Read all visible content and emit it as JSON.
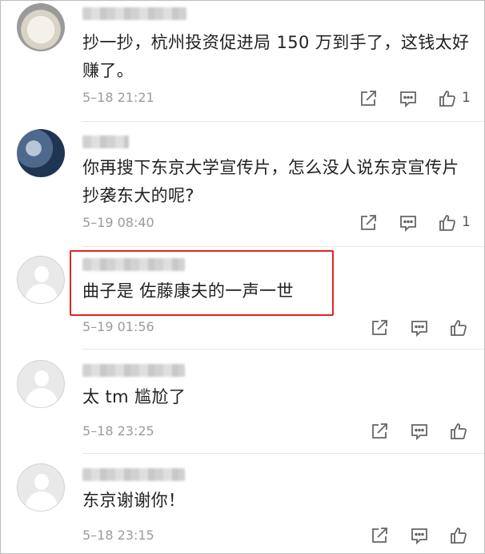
{
  "comments": [
    {
      "username": "user-1",
      "text": "抄一抄，杭州投资促进局 150 万到手了，这钱太好赚了。",
      "time": "5–18 21:21",
      "like_count": "1",
      "avatar": "photo-avatar"
    },
    {
      "username": "user-2",
      "text": "你再搜下东京大学宣传片，怎么没人说东京宣传片抄袭东大的呢?",
      "time": "5–19 08:40",
      "like_count": "1",
      "avatar": "photo-avatar"
    },
    {
      "username": "user-3",
      "text": "曲子是 佐藤康夫的一声一世",
      "time": "5–19 01:56",
      "like_count": "",
      "avatar": "default-avatar"
    },
    {
      "username": "user-4",
      "text": "太 tm 尴尬了",
      "time": "5–18 23:25",
      "like_count": "",
      "avatar": "default-avatar"
    },
    {
      "username": "user-5",
      "text": "东京谢谢你！",
      "time": "5–18 23:15",
      "like_count": "",
      "avatar": "default-avatar"
    }
  ],
  "icons": {
    "share": "share-icon",
    "reply": "reply-icon",
    "like": "thumbs-up-icon"
  },
  "colors": {
    "highlight": "#e02424",
    "text": "#222222",
    "meta": "#9b9b9b"
  }
}
